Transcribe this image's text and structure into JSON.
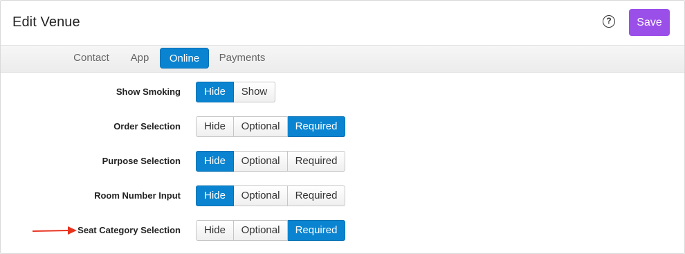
{
  "header": {
    "title": "Edit Venue",
    "help_icon": "help-circle-icon",
    "save_label": "Save",
    "save_color": "#9b4fe9"
  },
  "tabs": [
    {
      "label": "Contact",
      "active": false
    },
    {
      "label": "App",
      "active": false
    },
    {
      "label": "Online",
      "active": true
    },
    {
      "label": "Payments",
      "active": false
    }
  ],
  "accent_color": "#0a84d0",
  "settings": [
    {
      "label": "Show Smoking",
      "options": [
        "Hide",
        "Show"
      ],
      "selected": "Hide"
    },
    {
      "label": "Order Selection",
      "options": [
        "Hide",
        "Optional",
        "Required"
      ],
      "selected": "Required"
    },
    {
      "label": "Purpose Selection",
      "options": [
        "Hide",
        "Optional",
        "Required"
      ],
      "selected": "Hide"
    },
    {
      "label": "Room Number Input",
      "options": [
        "Hide",
        "Optional",
        "Required"
      ],
      "selected": "Hide"
    },
    {
      "label": "Seat Category Selection",
      "options": [
        "Hide",
        "Optional",
        "Required"
      ],
      "selected": "Required"
    }
  ],
  "annotation": {
    "icon": "red-arrow-icon",
    "color": "#e8321e"
  }
}
